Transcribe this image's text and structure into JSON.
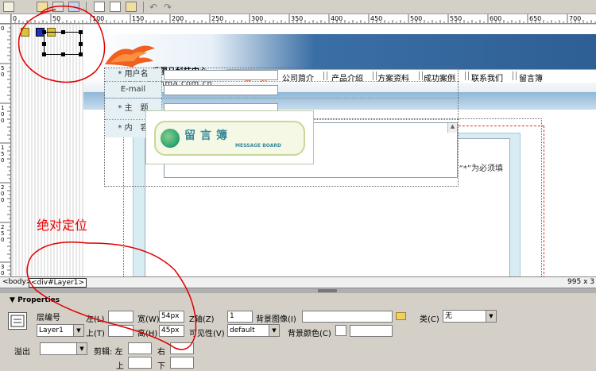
{
  "toolbar": {
    "icons": [
      "new-icon",
      "home-icon",
      "edit-icon",
      "save-icon",
      "cut-icon",
      "copy-icon",
      "paste-icon",
      "undo-icon",
      "redo-icon"
    ]
  },
  "ruler": {
    "h_ticks": [
      "0",
      "50",
      "100",
      "150",
      "200",
      "250",
      "300",
      "350",
      "400",
      "450",
      "500",
      "550",
      "600",
      "650",
      "700"
    ],
    "v_ticks": [
      "0",
      "5 0",
      "1 0 0",
      "1 5 0",
      "2 0 0",
      "2 5 0",
      "3 0 0"
    ]
  },
  "site": {
    "title": "千里马科技中心",
    "url": "www.qianma.com.cn",
    "nav": [
      "首　页",
      "公司简介",
      "产品介绍",
      "方案资料",
      "成功案例",
      "联系我们",
      "留言簿"
    ],
    "board_title": "留言簿",
    "board_subtitle": "MESSAGE BOARD",
    "required_note": "“*”为必须填",
    "form": {
      "username_label": "* 用户名",
      "email_label": "E-mail",
      "subject_label": "* 主　题",
      "content_label": "* 内　容"
    }
  },
  "statusbar": {
    "tags": [
      "<body>",
      "<div#Layer1>"
    ],
    "size": "995 x 3"
  },
  "properties": {
    "title": "Properties",
    "layer_id_label": "层编号",
    "layer_id_value": "Layer1",
    "left_label": "左(L)",
    "left_value": "",
    "top_label": "上(T)",
    "top_value": "",
    "width_label": "宽(W)",
    "width_value": "54px",
    "height_label": "高(H)",
    "height_value": "45px",
    "z_label": "Z轴(Z)",
    "z_value": "1",
    "visibility_label": "可见性(V)",
    "visibility_value": "default",
    "bg_image_label": "背景图像(I)",
    "bg_image_value": "",
    "bg_color_label": "背景颜色(C)",
    "bg_color_value": "",
    "class_label": "类(C)",
    "class_value": "无",
    "overflow_label": "溢出",
    "overflow_value": "",
    "clip_label": "剪辑: 左",
    "clip_right_label": "右",
    "clip_top_label": "上",
    "clip_bottom_label": "下"
  },
  "annotation": {
    "text": "绝对定位",
    "color": "#e00000"
  }
}
